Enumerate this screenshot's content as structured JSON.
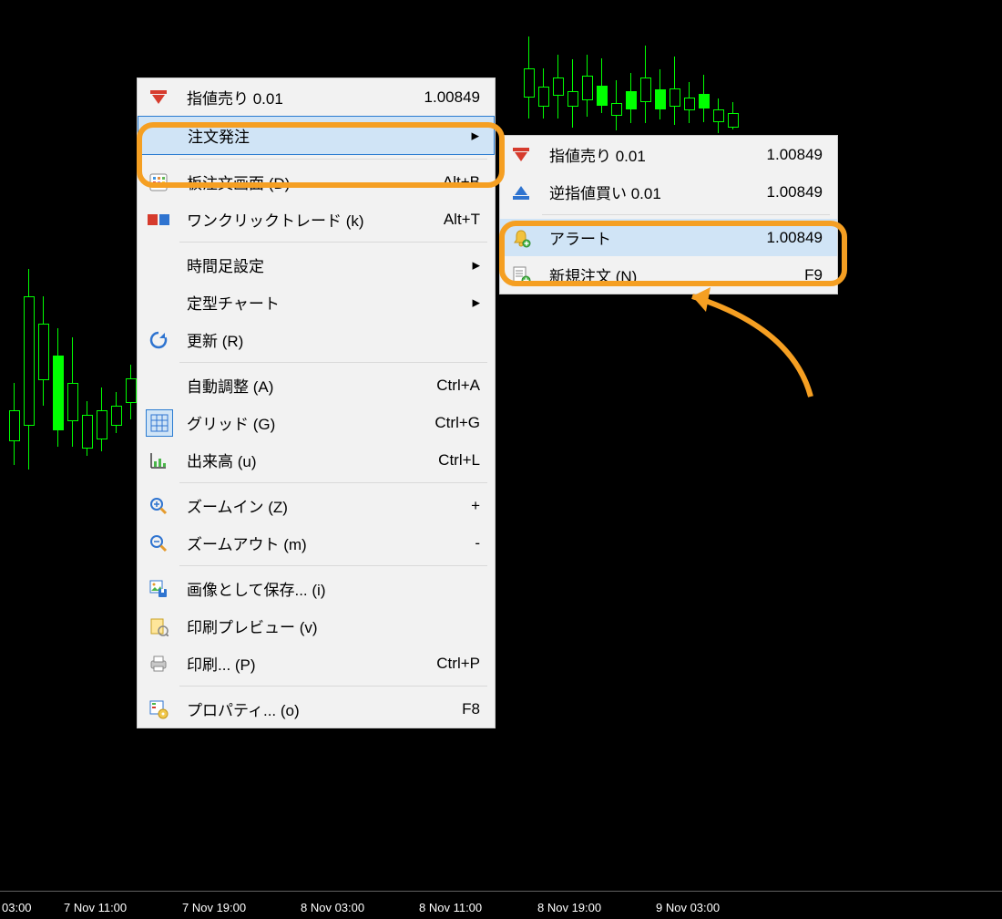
{
  "x_axis": [
    "03:00",
    "7 Nov 11:00",
    "7 Nov 19:00",
    "8 Nov 03:00",
    "8 Nov 11:00",
    "8 Nov 19:00",
    "9 Nov 03:00"
  ],
  "main_menu": {
    "items": [
      {
        "icon": "sell-arrow-icon",
        "label": "指値売り 0.01",
        "shortcut": "1.00849",
        "sep": false
      },
      {
        "icon": "",
        "label": "注文発注",
        "shortcut": "",
        "submenu": true,
        "highlight": true,
        "sep": true
      },
      {
        "icon": "depth-icon",
        "label": "板注文画面 (D)",
        "shortcut": "Alt+B",
        "sep": false
      },
      {
        "icon": "oneclick-icon",
        "label": "ワンクリックトレード (k)",
        "shortcut": "Alt+T",
        "sep": true
      },
      {
        "icon": "",
        "label": "時間足設定",
        "shortcut": "",
        "submenu": true,
        "sep": false
      },
      {
        "icon": "",
        "label": "定型チャート",
        "shortcut": "",
        "submenu": true,
        "sep": false
      },
      {
        "icon": "refresh-icon",
        "label": "更新 (R)",
        "shortcut": "",
        "sep": true
      },
      {
        "icon": "",
        "label": "自動調整 (A)",
        "shortcut": "Ctrl+A",
        "sep": false
      },
      {
        "icon": "grid-icon",
        "label": "グリッド (G)",
        "shortcut": "Ctrl+G",
        "sep": false
      },
      {
        "icon": "volume-icon",
        "label": "出来高 (u)",
        "shortcut": "Ctrl+L",
        "sep": true
      },
      {
        "icon": "zoomin-icon",
        "label": "ズームイン (Z)",
        "shortcut": "+",
        "sep": false
      },
      {
        "icon": "zoomout-icon",
        "label": "ズームアウト (m)",
        "shortcut": "-",
        "sep": true
      },
      {
        "icon": "saveimg-icon",
        "label": "画像として保存... (i)",
        "shortcut": "",
        "sep": false
      },
      {
        "icon": "printprev-icon",
        "label": "印刷プレビュー (v)",
        "shortcut": "",
        "sep": false
      },
      {
        "icon": "print-icon",
        "label": "印刷... (P)",
        "shortcut": "Ctrl+P",
        "sep": true
      },
      {
        "icon": "properties-icon",
        "label": "プロパティ... (o)",
        "shortcut": "F8",
        "sep": false
      }
    ]
  },
  "sub_menu": {
    "items": [
      {
        "icon": "sell-arrow-icon",
        "label": "指値売り 0.01",
        "shortcut": "1.00849",
        "sep": false
      },
      {
        "icon": "buy-arrow-icon",
        "label": "逆指値買い 0.01",
        "shortcut": "1.00849",
        "sep": true
      },
      {
        "icon": "alert-icon",
        "label": "アラート",
        "shortcut": "1.00849",
        "highlight": true,
        "sep": false
      },
      {
        "icon": "neworder-icon",
        "label": "新規注文 (N)",
        "shortcut": "F9",
        "sep": false
      }
    ]
  },
  "callouts": {
    "c1": "注文発注",
    "c2": "アラート"
  },
  "chart_data": {
    "type": "candlestick",
    "note": "pixel-approximate candles behind context menu; exact OHLC not readable",
    "candles": []
  }
}
